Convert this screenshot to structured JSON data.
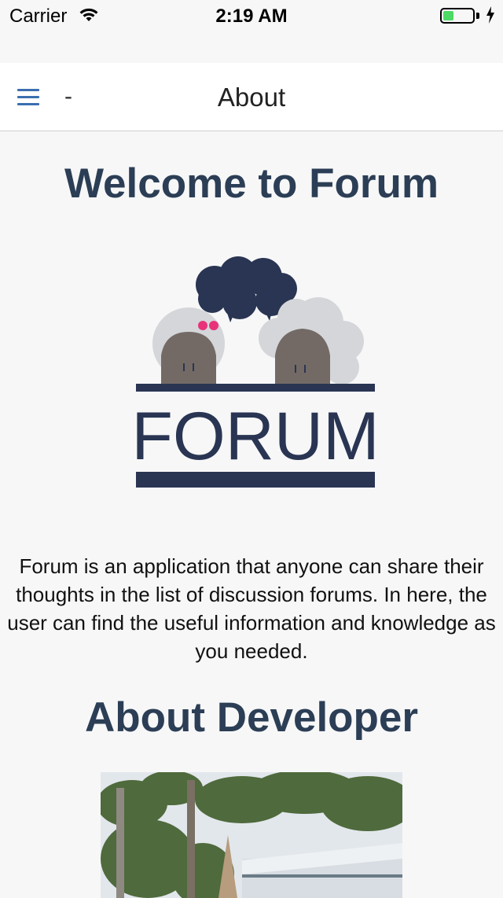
{
  "status_bar": {
    "carrier": "Carrier",
    "time": "2:19 AM",
    "battery_level": 0.35,
    "battery_color": "#4cd964"
  },
  "nav": {
    "menu_icon": "hamburger-menu-icon",
    "dash": "-",
    "title": "About",
    "accent": "#3b6fb0"
  },
  "main": {
    "welcome_title": "Welcome to Forum",
    "logo_text": "FORUM",
    "description": "Forum is an application that anyone can share their thoughts in the list of discussion forums. In here, the user can find the useful information and knowledge as you needed.",
    "about_title": "About Developer",
    "heading_color": "#2b3e55"
  }
}
